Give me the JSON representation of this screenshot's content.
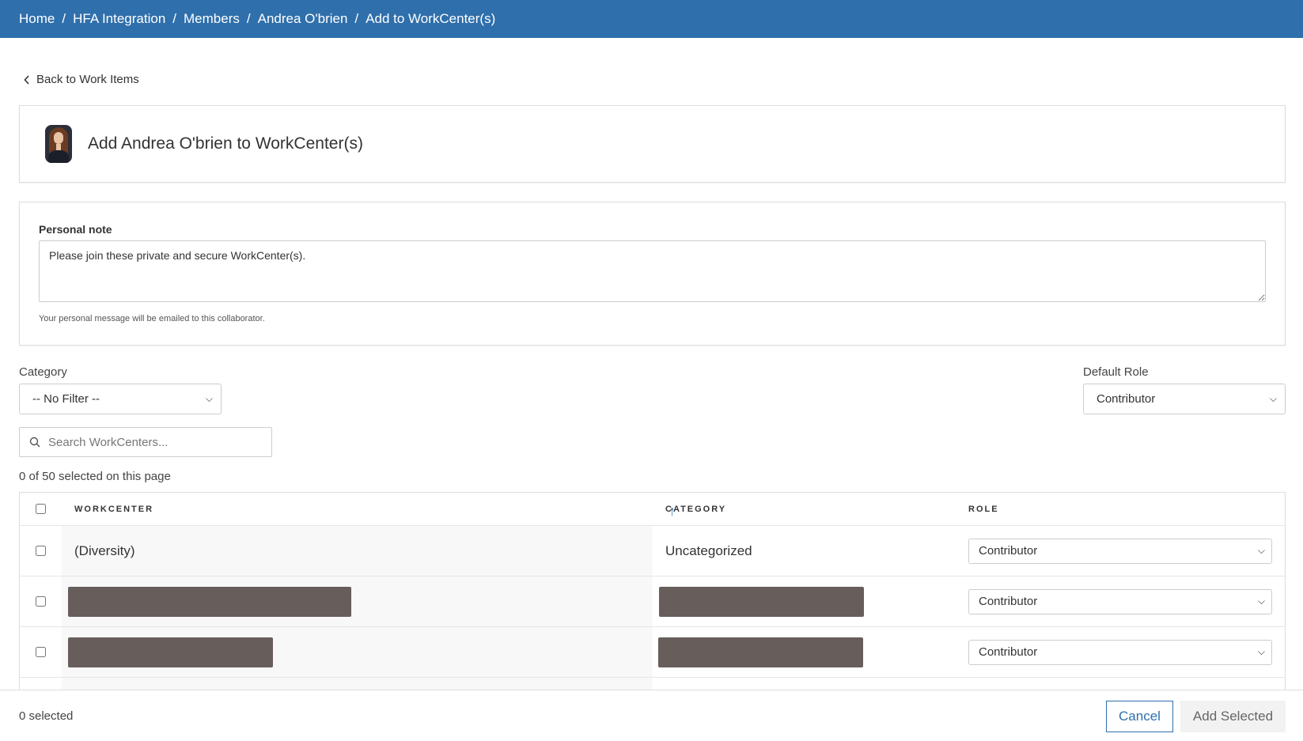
{
  "breadcrumb": [
    "Home",
    "HFA Integration",
    "Members",
    "Andrea O'brien",
    "Add to WorkCenter(s)"
  ],
  "back_link": "Back to Work Items",
  "page_title": "Add Andrea O'brien to WorkCenter(s)",
  "personal_note": {
    "label": "Personal note",
    "value": "Please join these private and secure WorkCenter(s).",
    "help": "Your personal message will be emailed to this collaborator."
  },
  "filters": {
    "category_label": "Category",
    "category_value": "-- No Filter --",
    "default_role_label": "Default Role",
    "default_role_value": "Contributor"
  },
  "search": {
    "placeholder": "Search WorkCenters..."
  },
  "selection_status": "0 of 50 selected on this page",
  "table": {
    "headers": {
      "workcenter": "WORKCENTER",
      "category": "CATEGORY",
      "role": "ROLE"
    },
    "sort_icon": "arrow-up-icon",
    "rows": [
      {
        "workcenter": "(Diversity)",
        "category": "Uncategorized",
        "role": "Contributor",
        "redacted": false
      },
      {
        "workcenter": "",
        "category": "",
        "role": "Contributor",
        "redacted": true
      },
      {
        "workcenter": "",
        "category": "",
        "role": "Contributor",
        "redacted": true
      }
    ]
  },
  "footer": {
    "selected_count": "0 selected",
    "cancel_label": "Cancel",
    "add_label": "Add Selected"
  },
  "colors": {
    "brand": "#2f6fab",
    "redaction": "#675e5c"
  }
}
